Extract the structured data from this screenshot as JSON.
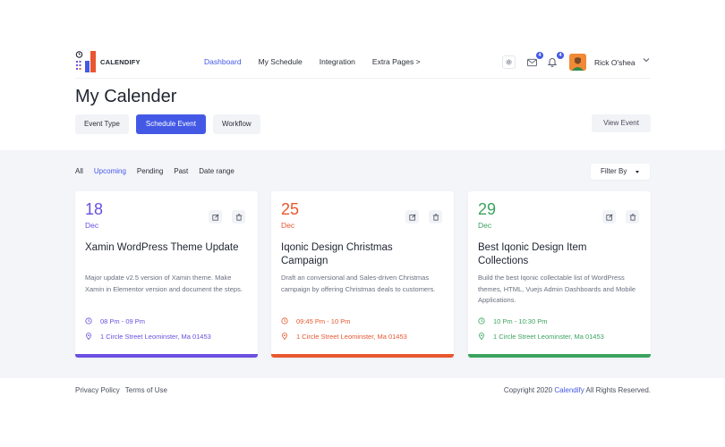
{
  "brand": {
    "name": "CALENDIFY"
  },
  "nav": {
    "items": [
      {
        "label": "Dashboard",
        "active": true
      },
      {
        "label": "My Schedule",
        "active": false
      },
      {
        "label": "Integration",
        "active": false
      },
      {
        "label": "Extra Pages >",
        "active": false
      }
    ],
    "mail_count": "4",
    "bell_count": "4",
    "user_name": "Rick O'shea"
  },
  "page": {
    "title": "My Calender"
  },
  "tabs": [
    {
      "label": "Event Type"
    },
    {
      "label": "Schedule Event"
    },
    {
      "label": "Workflow"
    }
  ],
  "view_event_label": "View Event",
  "filters": [
    {
      "label": "All"
    },
    {
      "label": "Upcoming"
    },
    {
      "label": "Pending"
    },
    {
      "label": "Past"
    },
    {
      "label": "Date range"
    }
  ],
  "filter_by_label": "Filter By",
  "events": [
    {
      "day": "18",
      "month": "Dec",
      "title": "Xamin WordPress Theme Update",
      "description": "Major update v2.5 version of Xamin theme. Make Xamin in Elementor version and document the steps.",
      "time": "08 Pm - 09 Pm",
      "location": "1 Circle Street Leominster, Ma 01453",
      "color": "#6a4fe0"
    },
    {
      "day": "25",
      "month": "Dec",
      "title": "Iqonic Design Christmas Campaign",
      "description": "Draft an conversional and Sales-driven Christmas campaign by offering Christmas deals to customers.",
      "time": "09:45 Pm - 10 Pm",
      "location": "1 Circle Street Leominster, Ma 01453",
      "color": "#e8572f"
    },
    {
      "day": "29",
      "month": "Dec",
      "title": "Best Iqonic Design Item Collections",
      "description": "Build the best Iqonic collectable list of WordPress themes, HTML, Vuejs Admin Dashboards and Mobile Applications.",
      "time": "10 Pm - 10:30 Pm",
      "location": "1 Circle Street Leominster, Ma 01453",
      "color": "#3aa35e"
    }
  ],
  "footer": {
    "links": [
      {
        "label": "Privacy Policy"
      },
      {
        "label": "Terms of Use"
      }
    ],
    "copyright_prefix": "Copyright 2020",
    "copyright_brand": "Calendify",
    "copyright_suffix": "All Rights Reserved."
  },
  "colors": {
    "accent": "#4359e6",
    "band": "#f4f5f9"
  }
}
